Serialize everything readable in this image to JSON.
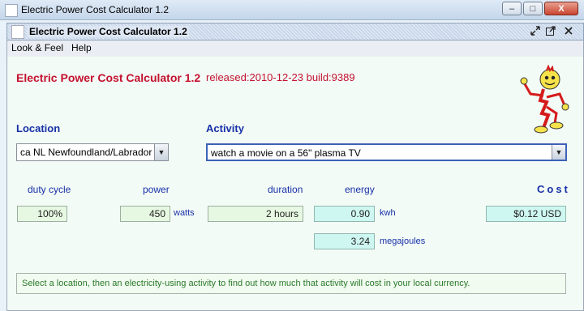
{
  "window": {
    "title": "Electric Power Cost Calculator 1.2",
    "min": "–",
    "max": "□",
    "close": "X"
  },
  "frame": {
    "title": "Electric Power Cost Calculator 1.2"
  },
  "menu": [
    "Look & Feel",
    "Help"
  ],
  "header": {
    "app_title": "Electric Power Cost Calculator 1.2",
    "release": "released:2010-12-23 build:9389"
  },
  "location": {
    "label": "Location",
    "value": "ca NL Newfoundland/Labrador"
  },
  "activity": {
    "label": "Activity",
    "value": "watch a movie on a 56\" plasma TV"
  },
  "columns": {
    "duty": "duty cycle",
    "power": "power",
    "duration": "duration",
    "energy": "energy",
    "cost": "Cost"
  },
  "values": {
    "duty": "100%",
    "power": "450",
    "power_unit": "watts",
    "duration": "2 hours",
    "energy_kwh": "0.90",
    "kwh_unit": "kwh",
    "energy_mj": "3.24",
    "mj_unit": "megajoules",
    "cost": "$0.12 USD"
  },
  "status": "Select a location, then an electricity-using activity to find out how much that activity will cost in your local currency.",
  "icons": [
    "app-icon",
    "reddy-kilowatt-mascot",
    "dropdown-arrow-icon",
    "restore-icon",
    "maximize-icon",
    "close-icon"
  ],
  "colors": {
    "title_red": "#c4122f",
    "label_blue": "#1630a8",
    "field_green": "#e7f8e2",
    "field_cyan": "#cff7f1"
  }
}
